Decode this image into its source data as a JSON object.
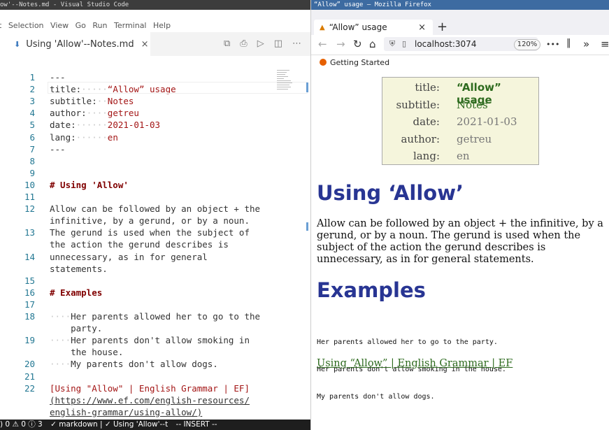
{
  "vscode": {
    "title": "ow'--Notes.md - Visual Studio Code",
    "menu": [
      "t",
      "Selection",
      "View",
      "Go",
      "Run",
      "Terminal",
      "Help"
    ],
    "tab": {
      "icon": "markdown-icon",
      "label": "Using 'Allow'--Notes.md",
      "close": "×"
    },
    "tab_actions": [
      "open-preview-side-icon",
      "print-icon",
      "run-icon",
      "split-editor-icon",
      "more-icon"
    ],
    "lines": [
      {
        "n": "1",
        "parts": [
          {
            "t": "---",
            "c": "key"
          }
        ]
      },
      {
        "n": "2",
        "parts": [
          {
            "t": "title:",
            "c": "key"
          },
          {
            "t": "·····",
            "c": "dot"
          },
          {
            "t": "“Allow” usage",
            "c": "val"
          }
        ]
      },
      {
        "n": "3",
        "parts": [
          {
            "t": "subtitle:",
            "c": "key"
          },
          {
            "t": "··",
            "c": "dot"
          },
          {
            "t": "Notes",
            "c": "val"
          }
        ]
      },
      {
        "n": "4",
        "parts": [
          {
            "t": "author:",
            "c": "key"
          },
          {
            "t": "····",
            "c": "dot"
          },
          {
            "t": "getreu",
            "c": "val"
          }
        ]
      },
      {
        "n": "5",
        "parts": [
          {
            "t": "date:",
            "c": "key"
          },
          {
            "t": "······",
            "c": "dot"
          },
          {
            "t": "2021-01-03",
            "c": "val"
          }
        ]
      },
      {
        "n": "6",
        "parts": [
          {
            "t": "lang:",
            "c": "key"
          },
          {
            "t": "······",
            "c": "dot"
          },
          {
            "t": "en",
            "c": "val"
          }
        ]
      },
      {
        "n": "7",
        "parts": [
          {
            "t": "---",
            "c": "key"
          }
        ]
      },
      {
        "n": "8",
        "parts": []
      },
      {
        "n": "9",
        "parts": []
      },
      {
        "n": "10",
        "parts": [
          {
            "t": "# Using 'Allow'",
            "c": "hdr"
          }
        ]
      },
      {
        "n": "11",
        "parts": []
      },
      {
        "n": "12",
        "parts": [
          {
            "t": "Allow can be followed by an object + the",
            "c": "key"
          }
        ]
      },
      {
        "n": "",
        "parts": [
          {
            "t": "infinitive, by a gerund, or by a noun.",
            "c": "key"
          }
        ]
      },
      {
        "n": "13",
        "parts": [
          {
            "t": "The gerund is used when the subject of",
            "c": "key"
          }
        ]
      },
      {
        "n": "",
        "parts": [
          {
            "t": "the action the gerund describes is",
            "c": "key"
          }
        ]
      },
      {
        "n": "14",
        "parts": [
          {
            "t": "unnecessary, as in for general",
            "c": "key"
          }
        ]
      },
      {
        "n": "",
        "parts": [
          {
            "t": "statements.",
            "c": "key"
          }
        ]
      },
      {
        "n": "15",
        "parts": []
      },
      {
        "n": "16",
        "parts": [
          {
            "t": "# Examples",
            "c": "hdr"
          }
        ]
      },
      {
        "n": "17",
        "parts": []
      },
      {
        "n": "18",
        "parts": [
          {
            "t": "····",
            "c": "dot"
          },
          {
            "t": "Her parents allowed her to go to the",
            "c": "key"
          }
        ]
      },
      {
        "n": "",
        "parts": [
          {
            "t": "    party.",
            "c": "key"
          }
        ]
      },
      {
        "n": "19",
        "parts": [
          {
            "t": "····",
            "c": "dot"
          },
          {
            "t": "Her parents don't allow smoking in",
            "c": "key"
          }
        ]
      },
      {
        "n": "",
        "parts": [
          {
            "t": "    the house.",
            "c": "key"
          }
        ]
      },
      {
        "n": "20",
        "parts": [
          {
            "t": "····",
            "c": "dot"
          },
          {
            "t": "My parents don't allow dogs.",
            "c": "key"
          }
        ]
      },
      {
        "n": "21",
        "parts": []
      },
      {
        "n": "22",
        "parts": [
          {
            "t": "[Using \"Allow\" | English Grammar | EF]",
            "c": "lnk"
          }
        ]
      },
      {
        "n": "",
        "parts": [
          {
            "t": "(https://www.ef.com/english-resources/",
            "c": "url"
          }
        ]
      },
      {
        "n": "",
        "parts": [
          {
            "t": "english-grammar/using-allow/)",
            "c": "url"
          }
        ]
      }
    ],
    "status": [
      ") 0 ⚠ 0 ⓘ 3",
      "✓ markdown | ✓ Using 'Allow'--t",
      "-- INSERT --"
    ]
  },
  "firefox": {
    "title": "“Allow” usage — Mozilla Firefox",
    "tab": {
      "label": "“Allow” usage",
      "close": "×"
    },
    "new_tab": "+",
    "url": "localhost:3074",
    "zoom": "120%",
    "nav_more": "•••",
    "bookmark": "Getting Started",
    "meta": [
      {
        "key": "title:",
        "value": "“Allow” usage",
        "style": "bold"
      },
      {
        "key": "subtitle:",
        "value": "Notes",
        "style": "green"
      },
      {
        "key": "date:",
        "value": "2021-01-03",
        "style": ""
      },
      {
        "key": "author:",
        "value": "getreu",
        "style": ""
      },
      {
        "key": "lang:",
        "value": "en",
        "style": ""
      }
    ],
    "heading1": "Using ‘Allow’",
    "paragraph": "Allow can be followed by an object + the infinitive, by a gerund, or by a noun. The gerund is used when the subject of the action the gerund describes is unnecessary, as in for general statements.",
    "heading2": "Examples",
    "code_lines": [
      "Her parents allowed her to go to the party.",
      "Her parents don't allow smoking in the house.",
      "My parents don't allow dogs."
    ],
    "link": "Using “Allow” | English Grammar | EF"
  }
}
